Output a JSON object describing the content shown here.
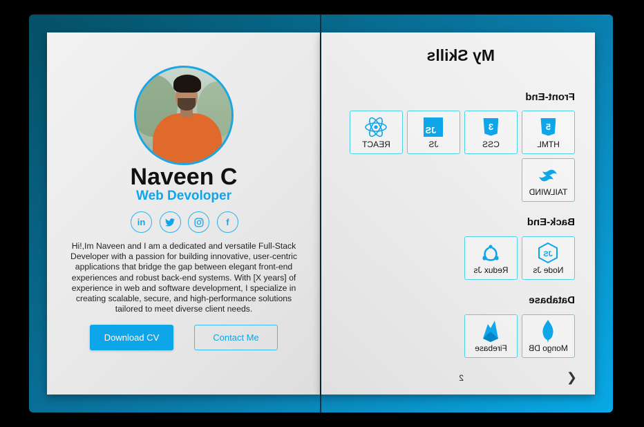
{
  "profile": {
    "name": "Naveen C",
    "role": "Web Devoloper",
    "bio": "Hi!,Im Naveen and I am a dedicated and versatile Full-Stack Developer with a passion for building innovative, user-centric applications that bridge the gap between elegant front-end experiences and robust back-end systems. With [X years] of experience in web and software development, I specialize in creating scalable, secure, and high-performance solutions tailored to meet diverse client needs.",
    "socials": [
      {
        "icon": "linkedin-icon",
        "glyph": "in"
      },
      {
        "icon": "twitter-icon",
        "glyph": "🐦"
      },
      {
        "icon": "instagram-icon",
        "glyph": "◎"
      },
      {
        "icon": "facebook-icon",
        "glyph": "f"
      }
    ],
    "download_label": "Download CV",
    "contact_label": "Contact Me"
  },
  "skills": {
    "title": "My Skills",
    "frontend_label": "Front-End",
    "backend_label": "Back-End",
    "database_label": "Database",
    "frontend": [
      {
        "label": "HTML",
        "glyph": "5",
        "icon": "html5-icon"
      },
      {
        "label": "CSS",
        "glyph": "3",
        "icon": "css3-icon"
      },
      {
        "label": "JS",
        "glyph": "JS",
        "icon": "javascript-icon"
      },
      {
        "label": "REACT",
        "glyph": "⚛",
        "icon": "react-icon"
      },
      {
        "label": "TAILWIND",
        "glyph": "≋",
        "icon": "tailwind-icon"
      }
    ],
    "backend": [
      {
        "label": "Node Js",
        "glyph": "JS",
        "icon": "nodejs-icon"
      },
      {
        "label": "Redux Js",
        "glyph": "⚛",
        "icon": "redux-icon"
      }
    ],
    "database": [
      {
        "label": "Mongo DB",
        "glyph": "❦",
        "icon": "mongodb-icon"
      },
      {
        "label": "Firebase",
        "glyph": "▲",
        "icon": "firebase-icon"
      }
    ],
    "page_number": "2",
    "next_glyph": "❮"
  },
  "colors": {
    "accent": "#0ea5e9",
    "cover_dark": "#055066",
    "cover_light": "#09a8e6"
  }
}
